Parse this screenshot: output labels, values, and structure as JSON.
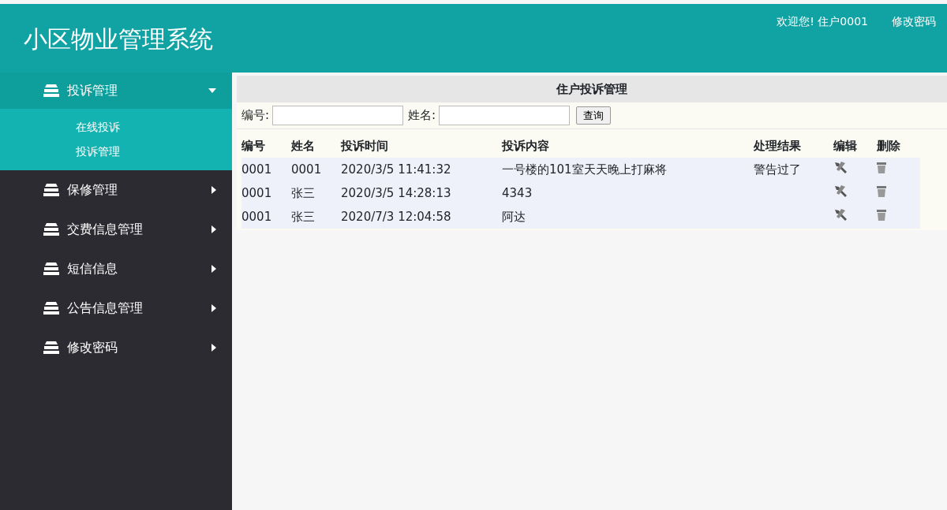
{
  "header": {
    "title": "小区物业管理系统",
    "greeting": "欢迎您!  住户0001",
    "change_password": "修改密码"
  },
  "sidebar": {
    "menus": [
      {
        "label": "投诉管理",
        "expanded": true,
        "children": [
          {
            "label": "在线投诉"
          },
          {
            "label": "投诉管理"
          }
        ]
      },
      {
        "label": "保修管理",
        "expanded": false
      },
      {
        "label": "交费信息管理",
        "expanded": false
      },
      {
        "label": "短信信息",
        "expanded": false
      },
      {
        "label": "公告信息管理",
        "expanded": false
      },
      {
        "label": "修改密码",
        "expanded": false
      }
    ]
  },
  "main": {
    "title": "住户投诉管理",
    "search": {
      "fields": [
        {
          "label": "编号:"
        },
        {
          "label": "姓名:"
        }
      ],
      "button": "查询"
    },
    "table": {
      "columns": [
        "编号",
        "姓名",
        "投诉时间",
        "投诉内容",
        "处理结果",
        "编辑",
        "删除"
      ],
      "rows": [
        {
          "cells": [
            "0001",
            "0001",
            "2020/3/5 11:41:32",
            "一号楼的101室天天晚上打麻将",
            "警告过了"
          ]
        },
        {
          "cells": [
            "0001",
            "张三",
            "2020/3/5 14:28:13",
            "4343",
            ""
          ]
        },
        {
          "cells": [
            "0001",
            "张三",
            "2020/7/3 12:04:58",
            "阿达",
            ""
          ]
        }
      ]
    }
  }
}
